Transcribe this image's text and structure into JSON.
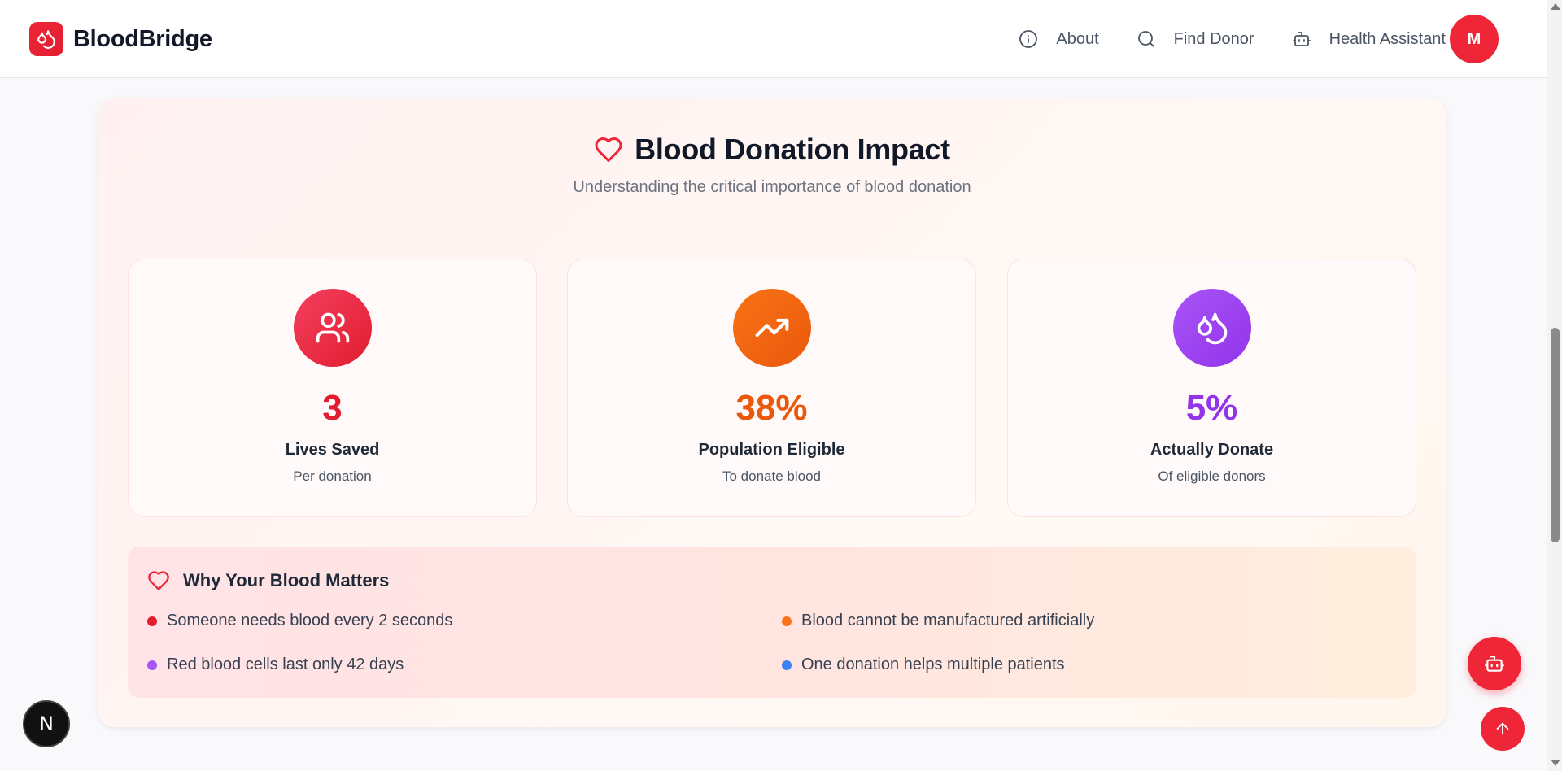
{
  "app": {
    "name": "BloodBridge",
    "logo_icon": "blood-drops-icon"
  },
  "nav": {
    "items": [
      {
        "label": "About",
        "icon": "info-icon"
      },
      {
        "label": "Find Donor",
        "icon": "search-icon"
      },
      {
        "label": "Health Assistant",
        "icon": "bot-icon"
      }
    ],
    "avatar_initial": "M"
  },
  "impact": {
    "title": "Blood Donation Impact",
    "subtitle": "Understanding the critical importance of blood donation",
    "stats": [
      {
        "value": "3",
        "label": "Lives Saved",
        "sub": "Per donation",
        "icon": "users-icon",
        "color": "#e11d2f"
      },
      {
        "value": "38%",
        "label": "Population Eligible",
        "sub": "To donate blood",
        "icon": "trending-up-icon",
        "color": "#ea580c"
      },
      {
        "value": "5%",
        "label": "Actually Donate",
        "sub": "Of eligible donors",
        "icon": "blood-drops-icon",
        "color": "#9333ea"
      }
    ],
    "why": {
      "title": "Why Your Blood Matters",
      "facts": [
        {
          "text": "Someone needs blood every 2 seconds",
          "color": "#e11d2f"
        },
        {
          "text": "Blood cannot be manufactured artificially",
          "color": "#f97316"
        },
        {
          "text": "Red blood cells last only 42 days",
          "color": "#a855f7"
        },
        {
          "text": "One donation helps multiple patients",
          "color": "#3b82f6"
        }
      ]
    }
  },
  "floating": {
    "next_badge": "N"
  },
  "colors": {
    "brand_red": "#ef2638",
    "orange": "#f97316",
    "purple": "#a855f7"
  }
}
